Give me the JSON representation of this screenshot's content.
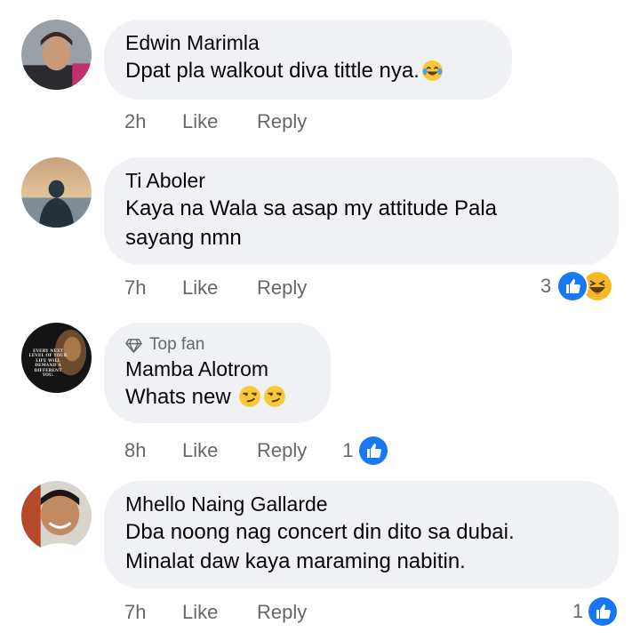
{
  "comments": [
    {
      "name": "Edwin Marimla",
      "text": "Dpat pla walkout diva tittle nya.",
      "emoji": "laughing-tears-emoji",
      "time": "2h",
      "like": "Like",
      "reply": "Reply"
    },
    {
      "name": "Ti Aboler",
      "text_line1": "Kaya na Wala sa asap my attitude Pala",
      "text_line2": "sayang nmn",
      "time": "7h",
      "like": "Like",
      "reply": "Reply",
      "reaction_count": "3",
      "reactions": [
        "like-reaction-icon",
        "haha-reaction-icon"
      ]
    },
    {
      "badge": "Top fan",
      "name": "Mamba Alotrom",
      "text": "Whats new",
      "emoji": "smirk-emoji",
      "avatar_text": "EVERY NEXT LEVEL OF YOUR LIFE WILL DEMAND A DIFFERENT YOU.",
      "time": "8h",
      "like": "Like",
      "reply": "Reply",
      "reaction_count": "1",
      "reactions": [
        "like-reaction-icon"
      ]
    },
    {
      "name": "Mhello Naing Gallarde",
      "text_line1": "Dba noong nag concert din dito sa dubai.",
      "text_line2": "Minalat daw kaya maraming nabitin.",
      "time": "7h",
      "like": "Like",
      "reply": "Reply",
      "reaction_count": "1",
      "reactions": [
        "like-reaction-icon"
      ]
    }
  ],
  "colors": {
    "bubble": "#eff1f4",
    "secondary_text": "#65676b",
    "like_blue": "#1877f2",
    "haha_yellow": "#f7b928"
  }
}
